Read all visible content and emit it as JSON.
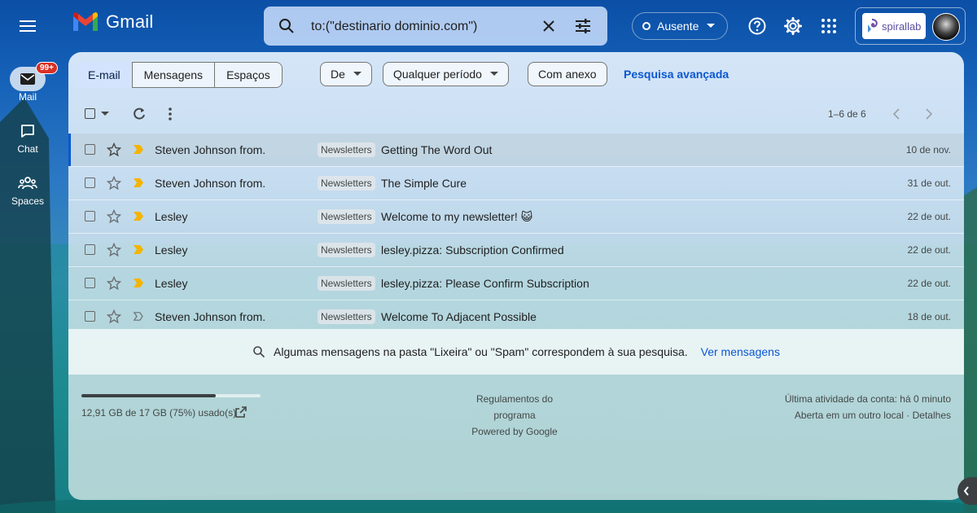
{
  "app": {
    "name": "Gmail"
  },
  "search": {
    "value": "to:(\"destinario dominio.com\")"
  },
  "header": {
    "status_label": "Ausente",
    "account_brand": "spirallab"
  },
  "rail": {
    "mail": {
      "label": "Mail",
      "badge": "99+"
    },
    "chat": {
      "label": "Chat"
    },
    "spaces": {
      "label": "Spaces"
    }
  },
  "filters": {
    "tabs": [
      "E-mail",
      "Mensagens",
      "Espaços"
    ],
    "from_label": "De",
    "period_label": "Qualquer período",
    "attachment_label": "Com anexo",
    "advanced_label": "Pesquisa avançada"
  },
  "pagination": {
    "label": "1–6 de 6"
  },
  "emails": [
    {
      "from": "Steven Johnson from.",
      "label": "Newsletters",
      "subject": "Getting The Word Out",
      "date": "10 de nov.",
      "important": true
    },
    {
      "from": "Steven Johnson from.",
      "label": "Newsletters",
      "subject": "The Simple Cure",
      "date": "31 de out.",
      "important": true
    },
    {
      "from": "Lesley",
      "label": "Newsletters",
      "subject": "Welcome to my newsletter! 😺",
      "date": "22 de out.",
      "important": true
    },
    {
      "from": "Lesley",
      "label": "Newsletters",
      "subject": "lesley.pizza: Subscription Confirmed",
      "date": "22 de out.",
      "important": true
    },
    {
      "from": "Lesley",
      "label": "Newsletters",
      "subject": "lesley.pizza: Please Confirm Subscription",
      "date": "22 de out.",
      "important": true
    },
    {
      "from": "Steven Johnson from.",
      "label": "Newsletters",
      "subject": "Welcome To Adjacent Possible",
      "date": "18 de out.",
      "important": false
    }
  ],
  "notice": {
    "text": "Algumas mensagens na pasta \"Lixeira\" ou \"Spam\" correspondem à sua pesquisa.",
    "link": "Ver mensagens"
  },
  "footer": {
    "storage_text": "12,91 GB de 17 GB (75%) usado(s)",
    "storage_fraction": 0.75,
    "program_policies": "Regulamentos do programa",
    "powered_by": "Powered by Google",
    "last_activity": "Última atividade da conta: há 0 minuto",
    "open_elsewhere": "Aberta em um outro local · Detalhes"
  },
  "colors": {
    "accent": "#0b57d0",
    "important_marker": "#f4b400",
    "badge": "#d93025"
  }
}
